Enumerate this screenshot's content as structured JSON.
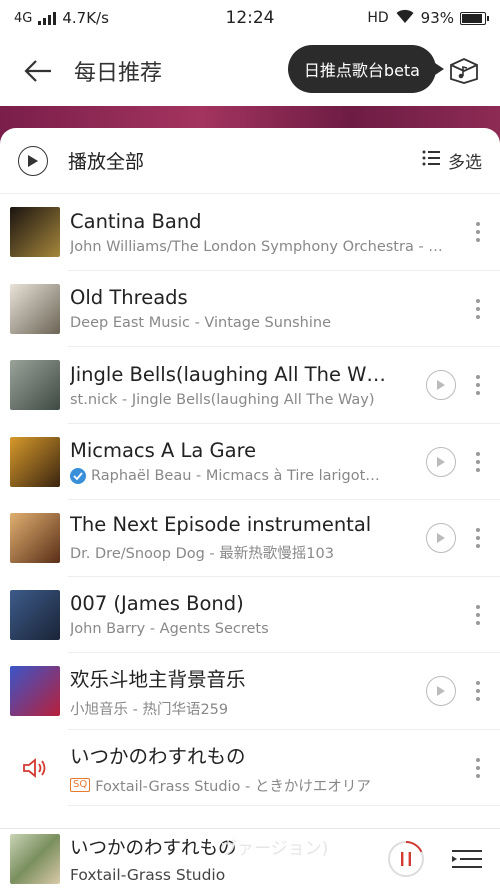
{
  "status_bar": {
    "network": "4G",
    "speed": "4.7K/s",
    "time": "12:24",
    "hd": "HD",
    "battery": "93%",
    "battery_level": 0.93
  },
  "header": {
    "title": "每日推荐",
    "beta_bubble": "日推点歌台beta"
  },
  "toolbar": {
    "play_all": "播放全部",
    "multi_select": "多选"
  },
  "songs": [
    {
      "title": "Cantina Band",
      "subtitle": "John Williams/The London Symphony Orchestra - …",
      "has_mv": false,
      "badge": "",
      "cover_colors": [
        "#1b1410",
        "#a5873c"
      ]
    },
    {
      "title": "Old Threads",
      "subtitle": "Deep East Music - Vintage Sunshine",
      "has_mv": false,
      "badge": "",
      "cover_colors": [
        "#e8e2d8",
        "#6b6456"
      ]
    },
    {
      "title": "Jingle Bells(laughing All The W…",
      "subtitle": "st.nick - Jingle Bells(laughing All The Way)",
      "has_mv": true,
      "badge": "",
      "cover_colors": [
        "#9aa39a",
        "#3f4a44"
      ]
    },
    {
      "title": "Micmacs A La Gare",
      "subtitle": "Raphaël Beau - Micmacs à Tire larigot…",
      "has_mv": true,
      "badge": "verified",
      "cover_colors": [
        "#d79a2b",
        "#3a2410"
      ]
    },
    {
      "title": "The Next Episode instrumental",
      "subtitle": "Dr. Dre/Snoop Dog - 最新热歌慢摇103",
      "has_mv": true,
      "badge": "",
      "cover_colors": [
        "#e0b070",
        "#5a2e18"
      ]
    },
    {
      "title": "007 (James Bond)",
      "subtitle": "John Barry - Agents Secrets",
      "has_mv": false,
      "badge": "",
      "cover_colors": [
        "#3d5b8a",
        "#1a2436"
      ]
    },
    {
      "title": "欢乐斗地主背景音乐",
      "subtitle": "小旭音乐 - 热门华语259",
      "has_mv": true,
      "badge": "",
      "cover_colors": [
        "#3a55c9",
        "#b8203a"
      ]
    },
    {
      "title": "いつかのわすれもの",
      "subtitle": "Foxtail-Grass Studio - ときかけエオリア",
      "has_mv": false,
      "badge": "SQ",
      "playing": true,
      "cover_colors": [
        "#ffffff",
        "#ffffff"
      ]
    }
  ],
  "player": {
    "title": "いつかのわすれもの",
    "artist": "Foxtail-Grass Studio",
    "lyric_ghost": "ヴァージョン)",
    "progress": 0.18
  },
  "colors": {
    "accent": "#d33a31",
    "banner": "#8d2b55"
  }
}
